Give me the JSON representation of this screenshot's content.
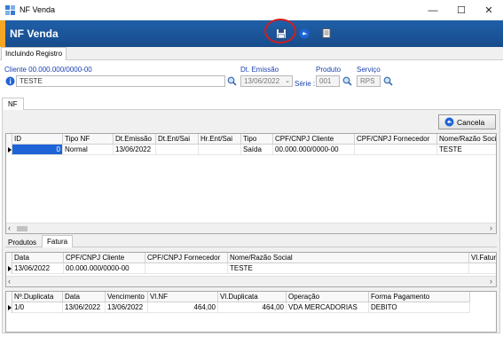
{
  "window": {
    "title": "NF Venda",
    "minimize": "—",
    "maximize": "☐",
    "close": "✕"
  },
  "header": {
    "title": "NF Venda"
  },
  "tabs": {
    "main": "Incluindo Registro",
    "nf": "NF"
  },
  "form": {
    "cliente_label": "Cliente 00.000.000/0000-00",
    "cliente_value": "TESTE",
    "emissao_label": "Dt. Emissão",
    "emissao_value": "13/06/2022",
    "serie_label": "Série :",
    "produto_label": "Produto",
    "produto_value": "001",
    "servico_label": "Serviço",
    "servico_value": "RPS"
  },
  "buttons": {
    "cancel": "Cancela"
  },
  "nf_grid": {
    "columns": [
      "ID",
      "Tipo NF",
      "Dt.Emissão",
      "Dt.Ent/Sai",
      "Hr.Ent/Sai",
      "Tipo",
      "CPF/CNPJ Cliente",
      "CPF/CNPJ Fornecedor",
      "Nome/Razão Social"
    ],
    "rows": [
      [
        "0",
        "Normal",
        "13/06/2022",
        "",
        "",
        "Saída",
        "00.000.000/0000-00",
        "",
        "TESTE"
      ]
    ]
  },
  "sub_tabs": [
    "Produtos",
    "Fatura"
  ],
  "fatura_grid": {
    "columns": [
      "Data",
      "CPF/CNPJ Cliente",
      "CPF/CNPJ  Fornecedor",
      "Nome/Razão Social",
      "Vl.Fatura"
    ],
    "rows": [
      [
        "13/06/2022",
        "00.000.000/0000-00",
        "",
        "TESTE",
        ""
      ]
    ]
  },
  "dup_grid": {
    "columns": [
      "Nº.Duplicata",
      "Data",
      "Vencimento",
      "Vl.NF",
      "Vl.Duplicata",
      "Operação",
      "Forma Pagamento"
    ],
    "rows": [
      [
        "1/0",
        "13/06/2022",
        "13/06/2022",
        "464,00",
        "464,00",
        "VDA MERCADORIAS",
        "DEBITO"
      ]
    ]
  },
  "colors": {
    "header_blue": "#1f5fa8",
    "accent_orange": "#f5a623",
    "highlight_red": "#d81b1b",
    "selection_blue": "#1e64d6"
  }
}
